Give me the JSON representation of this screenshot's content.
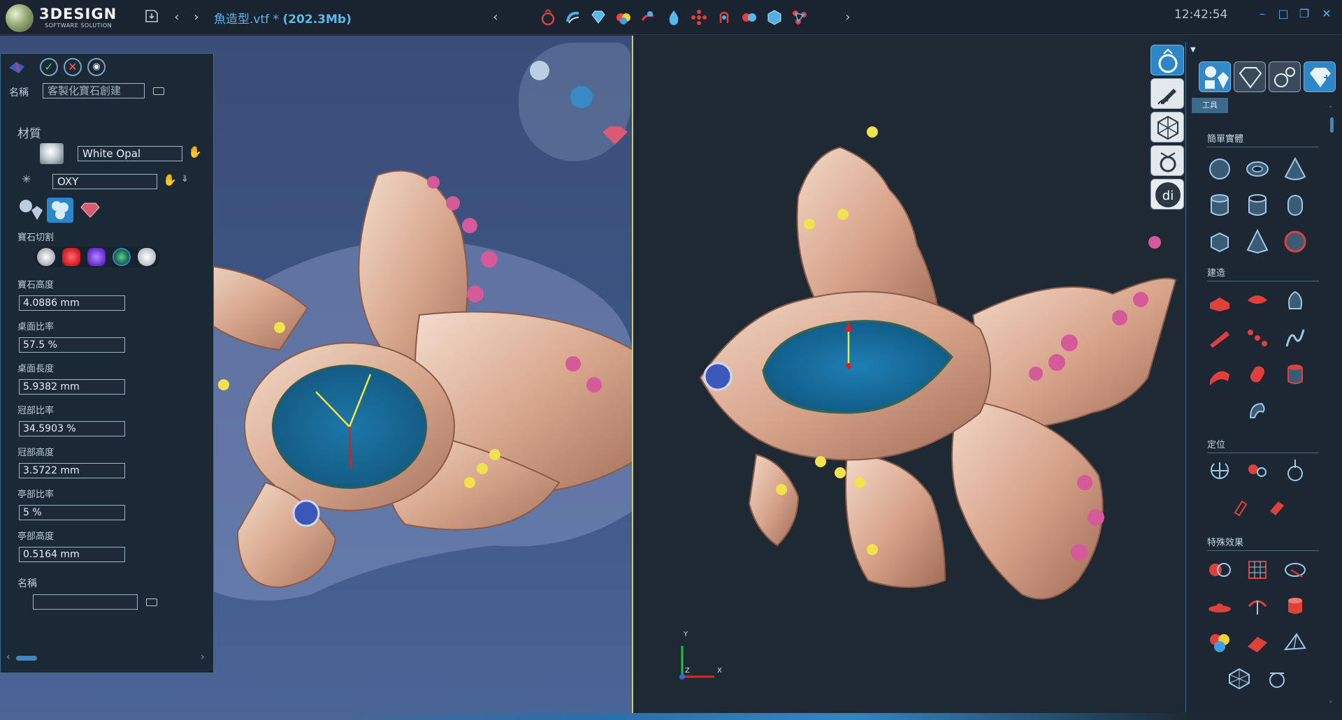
{
  "app": {
    "logo_name": "3DESIGN",
    "logo_sub": "SOFTWARE SOLUTION",
    "doc_title": "魚造型.vtf *",
    "doc_size": "(202.3Mb)",
    "clock": "12:42:54"
  },
  "icons": {
    "save": "save-icon",
    "back": "chevron-left-icon",
    "forward": "chevron-right-icon",
    "minimize": "minimize-icon",
    "maximize": "maximize-icon",
    "restore": "restore-icon",
    "close": "close-icon"
  },
  "panel": {
    "name_label": "名稱",
    "name_value": "客製化寶石創建",
    "material_label": "材質",
    "material_value": "White Opal",
    "axis_value": "OXY",
    "gem_cut_label": "寶石切割",
    "fields": [
      {
        "label": "寶石高度",
        "value": "4.0886 mm"
      },
      {
        "label": "桌面比率",
        "value": "57.5 %"
      },
      {
        "label": "桌面長度",
        "value": "5.9382 mm"
      },
      {
        "label": "冠部比率",
        "value": "34.5903 %"
      },
      {
        "label": "冠部高度",
        "value": "3.5722 mm"
      },
      {
        "label": "亭部比率",
        "value": "5 %"
      },
      {
        "label": "亭部高度",
        "value": "0.5164 mm"
      }
    ],
    "name2_label": "名稱",
    "name2_value": ""
  },
  "toolpanel": {
    "chip": "工具",
    "sections": [
      "簡單實體",
      "建造",
      "定位",
      "特殊效果"
    ]
  },
  "axes": {
    "x": "X",
    "y": "Y",
    "z": "Z"
  },
  "colors": {
    "accent": "#2f86c5",
    "title_blue": "#5fb6e8",
    "gold": "#e8c9b3",
    "pink_gem": "#d45a9a",
    "yellow_gem": "#f1e24e"
  }
}
